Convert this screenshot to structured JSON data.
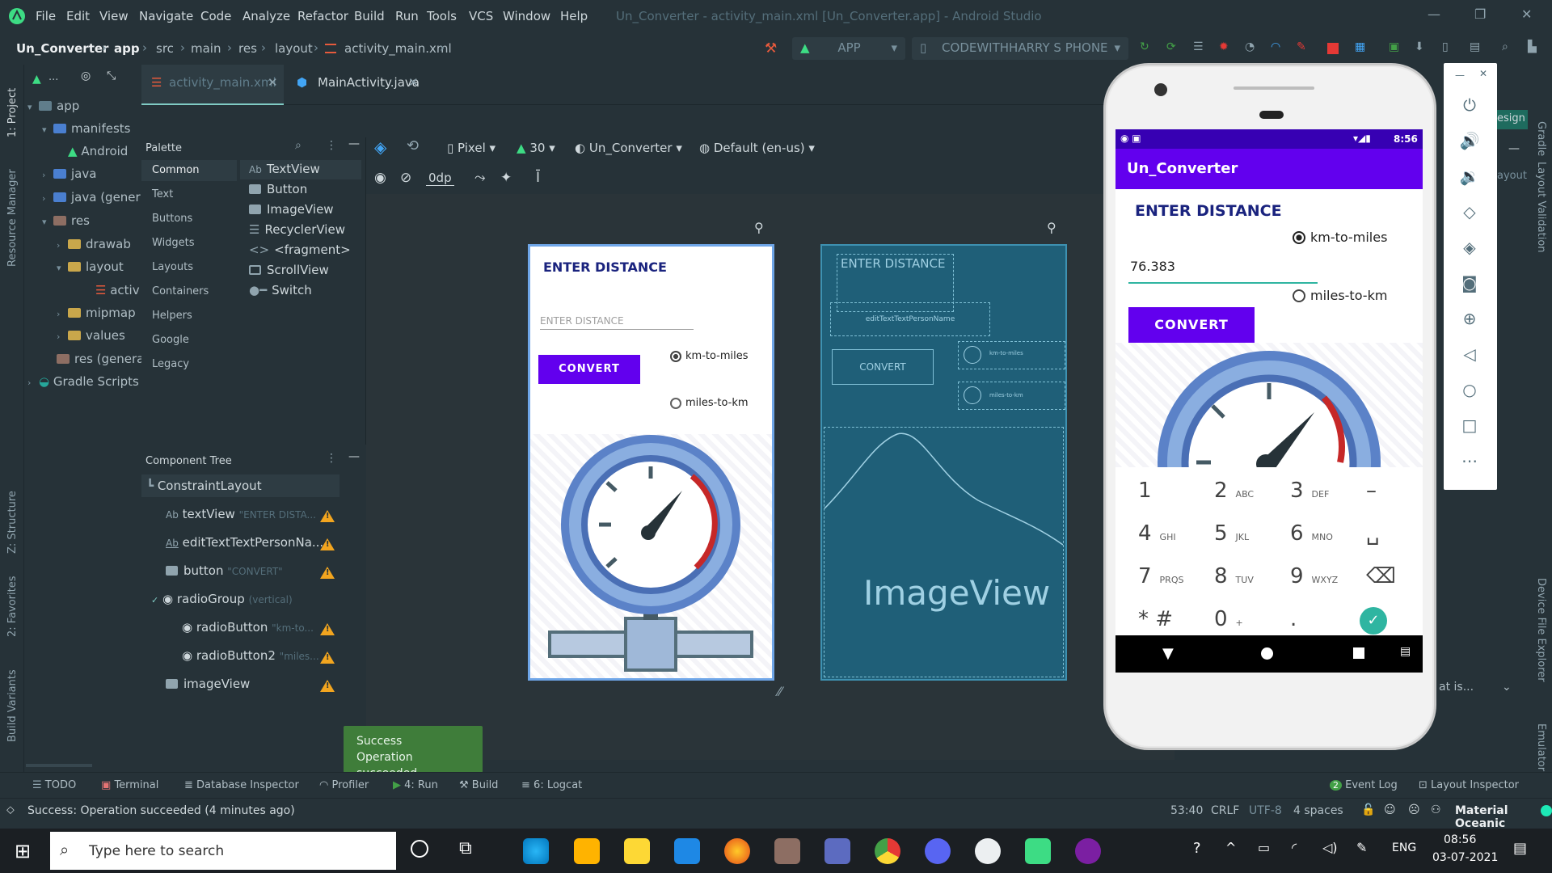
{
  "menu": {
    "items": [
      "File",
      "Edit",
      "View",
      "Navigate",
      "Code",
      "Analyze",
      "Refactor",
      "Build",
      "Run",
      "Tools",
      "VCS",
      "Window",
      "Help"
    ],
    "window_title": "Un_Converter - activity_main.xml [Un_Converter.app] - Android Studio"
  },
  "nav": {
    "crumbs": [
      "Un_Converter",
      "app",
      "src",
      "main",
      "res",
      "layout",
      "activity_main.xml"
    ],
    "run_config": "APP",
    "device": "CODEWITHHARRY S PHONE"
  },
  "project": {
    "toolbar_label": "...",
    "items": {
      "app": "app",
      "manifests": "manifests",
      "android": "Android",
      "java": "java",
      "java_gen": "java (gener",
      "res": "res",
      "drawable": "drawab",
      "layout": "layout",
      "activ": "activ",
      "mipmap": "mipmap",
      "values": "values",
      "res_gen": "res (genera",
      "gradle": "Gradle Scripts"
    }
  },
  "left_strip": {
    "project": "1: Project",
    "resource": "Resource Manager",
    "structure": "Z: Structure",
    "favorites": "2: Favorites",
    "variants": "Build Variants"
  },
  "tabs": [
    {
      "label": "activity_main.xml"
    },
    {
      "label": "MainActivity.java"
    }
  ],
  "palette": {
    "title": "Palette",
    "categories": [
      "Common",
      "Text",
      "Buttons",
      "Widgets",
      "Layouts",
      "Containers",
      "Helpers",
      "Google",
      "Legacy"
    ],
    "items": [
      "TextView",
      "Button",
      "ImageView",
      "RecyclerView",
      "<fragment>",
      "ScrollView",
      "Switch"
    ]
  },
  "design_toolbar": {
    "device": "Pixel",
    "api": "30",
    "theme": "Un_Converter",
    "locale": "Default (en-us)",
    "margin": "0dp"
  },
  "component_tree": {
    "title": "Component Tree",
    "root": "ConstraintLayout",
    "nodes": [
      {
        "name": "textView",
        "hint": "\"ENTER DISTA..."
      },
      {
        "name": "editTextTextPersonNa...",
        "hint": ""
      },
      {
        "name": "button",
        "hint": "\"CONVERT\""
      },
      {
        "name": "radioGroup",
        "hint": "(vertical)"
      },
      {
        "name": "radioButton",
        "hint": "\"km-to..."
      },
      {
        "name": "radioButton2",
        "hint": "\"miles..."
      },
      {
        "name": "imageView",
        "hint": ""
      }
    ]
  },
  "design_preview": {
    "heading": "ENTER DISTANCE",
    "input_hint": "ENTER DISTANCE",
    "button": "CONVERT",
    "radio1": "km-to-miles",
    "radio2": "miles-to-km"
  },
  "blueprint": {
    "heading": "ENTER DISTANCE",
    "edit": "editTextTextPersonName",
    "button": "CONVERT",
    "radio1": "km-to-miles",
    "radio2": "miles-to-km",
    "image": "ImageView"
  },
  "emulator": {
    "time": "8:56",
    "app_title": "Un_Converter",
    "heading": "ENTER DISTANCE",
    "radio1": "km-to-miles",
    "radio2": "miles-to-km",
    "input_value": "76.383",
    "button": "CONVERT",
    "keys": [
      {
        "d": "1",
        "s": ""
      },
      {
        "d": "2",
        "s": "ABC"
      },
      {
        "d": "3",
        "s": "DEF"
      },
      {
        "d": "–",
        "s": ""
      },
      {
        "d": "4",
        "s": "GHI"
      },
      {
        "d": "5",
        "s": "JKL"
      },
      {
        "d": "6",
        "s": "MNO"
      },
      {
        "d": "␣",
        "s": ""
      },
      {
        "d": "7",
        "s": "PRQS"
      },
      {
        "d": "8",
        "s": "TUV"
      },
      {
        "d": "9",
        "s": "WXYZ"
      },
      {
        "d": "⌫",
        "s": ""
      },
      {
        "d": "* #",
        "s": ""
      },
      {
        "d": "0",
        "s": "+"
      },
      {
        "d": ".",
        "s": ""
      },
      {
        "d": "✓",
        "s": ""
      }
    ]
  },
  "right_strip": {
    "gradle": "Gradle",
    "validation": "Layout Validation",
    "explorer": "Device File Explorer",
    "emulator": "Emulator",
    "design": "esign",
    "layout": "ayout",
    "what": "at is..."
  },
  "toast": {
    "line1": "Success",
    "line2": "Operation succeeded"
  },
  "bottom_tools": [
    "TODO",
    "Terminal",
    "Database Inspector",
    "Profiler",
    "4: Run",
    "Build",
    "6: Logcat"
  ],
  "bottom_right": {
    "event_log": "Event Log",
    "event_count": "2",
    "layout_inspector": "Layout Inspector"
  },
  "status": {
    "message": "Success: Operation succeeded (4 minutes ago)",
    "position": "53:40",
    "line_sep": "CRLF",
    "encoding": "UTF-8",
    "indent": "4 spaces",
    "theme": "Material Oceanic"
  },
  "taskbar": {
    "search_placeholder": "Type here to search",
    "lang": "ENG",
    "time": "08:56",
    "date": "03-07-2021"
  },
  "colors": {
    "accent": "#6200ee",
    "heading": "#1a237e",
    "teal": "#2fb5a1"
  }
}
